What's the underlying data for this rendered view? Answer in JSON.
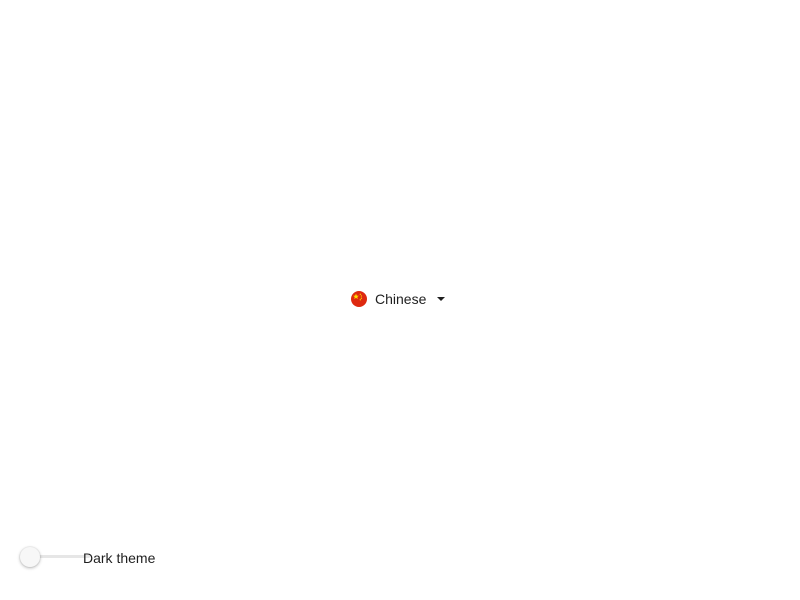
{
  "language_selector": {
    "selected_label": "Chinese",
    "flag_icon": "china-flag-icon",
    "dropdown_icon": "caret-down-icon"
  },
  "theme": {
    "toggle_label": "Dark theme",
    "dark_enabled": false
  },
  "colors": {
    "flag_red": "#de2910",
    "flag_star": "#ffde00",
    "text": "#1f1f1f",
    "track": "#e6e6e6",
    "thumb": "#f7f7f7"
  }
}
